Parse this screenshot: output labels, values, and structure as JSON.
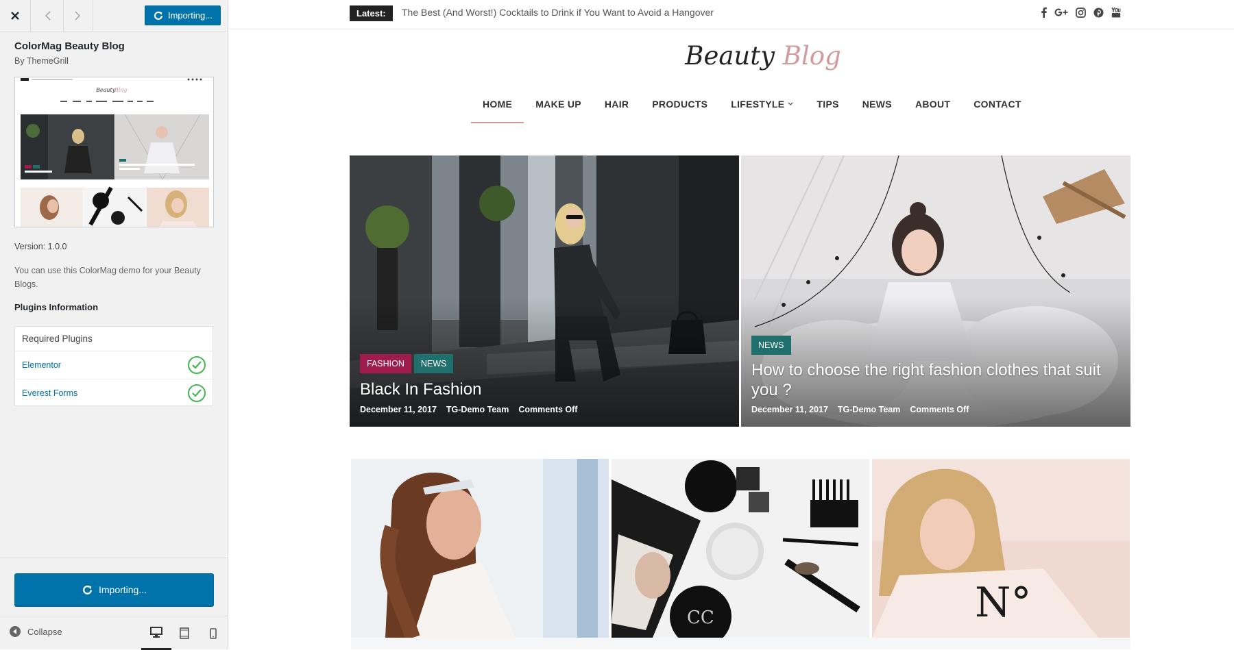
{
  "sidebar": {
    "importing_label": "Importing...",
    "theme_title": "ColorMag Beauty Blog",
    "theme_author": "By ThemeGrill",
    "version": "Version: 1.0.0",
    "description": "You can use this ColorMag demo for your Beauty Blogs.",
    "plugins_heading": "Plugins Information",
    "required_plugins_label": "Required Plugins",
    "plugins": [
      {
        "name": "Elementor",
        "status": "installed"
      },
      {
        "name": "Everest Forms",
        "status": "installed"
      }
    ],
    "import_button_label": "Importing...",
    "collapse_label": "Collapse",
    "accent": "#0073aa",
    "check_color": "#46b450"
  },
  "preview": {
    "latest_label": "Latest:",
    "latest_headline": "The Best (And Worst!) Cocktails to Drink if You Want to Avoid a Hangover",
    "socials": [
      "facebook-icon",
      "google-plus-icon",
      "instagram-icon",
      "pinterest-icon",
      "youtube-icon"
    ],
    "logo": {
      "word1": "Beauty",
      "word2": "Blog",
      "accent": "#d39a9e"
    },
    "nav": [
      {
        "label": "HOME",
        "active": true
      },
      {
        "label": "MAKE UP"
      },
      {
        "label": "HAIR"
      },
      {
        "label": "PRODUCTS"
      },
      {
        "label": "LIFESTYLE",
        "dropdown": true
      },
      {
        "label": "TIPS"
      },
      {
        "label": "NEWS"
      },
      {
        "label": "ABOUT"
      },
      {
        "label": "CONTACT"
      }
    ],
    "features": [
      {
        "tags": [
          "FASHION",
          "NEWS"
        ],
        "title": "Black In Fashion",
        "date": "December 11, 2017",
        "author": "TG-Demo Team",
        "comments": "Comments Off"
      },
      {
        "tags": [
          "NEWS"
        ],
        "title": "How to choose the right fashion clothes that suit you ?",
        "date": "December 11, 2017",
        "author": "TG-Demo Team",
        "comments": "Comments Off"
      }
    ],
    "tag_colors": {
      "fashion": "#9e1b4b",
      "news": "#1f6f6d"
    }
  }
}
